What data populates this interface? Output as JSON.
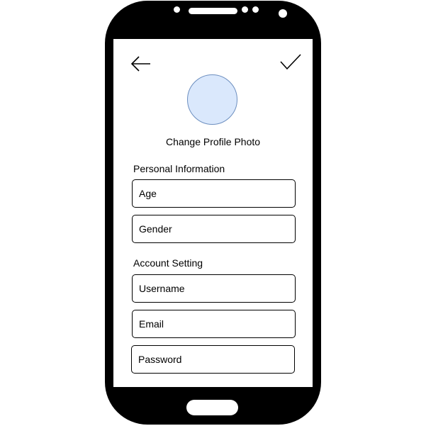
{
  "header": {
    "back_icon": "arrow-left-icon",
    "confirm_icon": "checkmark-icon"
  },
  "profile": {
    "change_photo_label": "Change Profile Photo",
    "avatar_color": "#dae8fc"
  },
  "personal_information": {
    "heading": "Personal Information",
    "fields": {
      "age": "Age",
      "gender": "Gender"
    }
  },
  "account_setting": {
    "heading": "Account Setting",
    "fields": {
      "username": "Username",
      "email": "Email",
      "password": "Password"
    }
  }
}
